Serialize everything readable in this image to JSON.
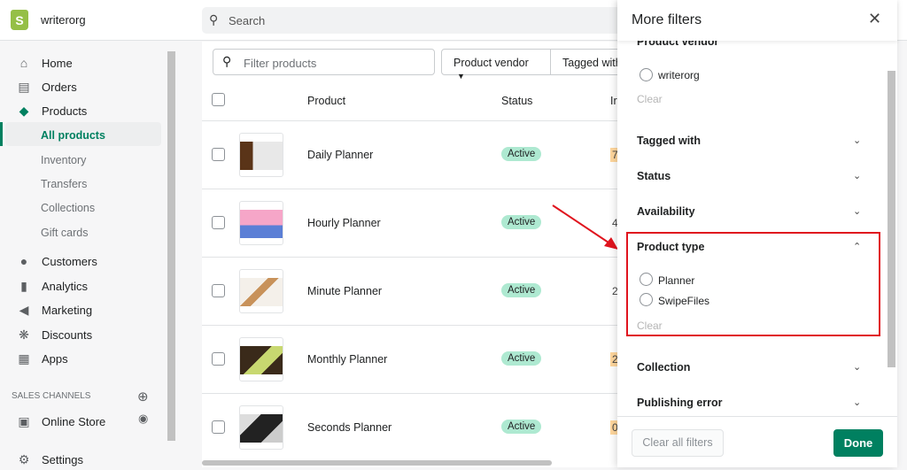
{
  "store": {
    "name": "writerorg"
  },
  "search": {
    "placeholder": "Search"
  },
  "sidebar": {
    "items": [
      {
        "label": "Home",
        "icon": "home-icon"
      },
      {
        "label": "Orders",
        "icon": "orders-icon"
      },
      {
        "label": "Products",
        "icon": "tag-icon"
      },
      {
        "label": "Customers",
        "icon": "person-icon"
      },
      {
        "label": "Analytics",
        "icon": "bar-chart-icon"
      },
      {
        "label": "Marketing",
        "icon": "megaphone-icon"
      },
      {
        "label": "Discounts",
        "icon": "discount-icon"
      },
      {
        "label": "Apps",
        "icon": "apps-icon"
      }
    ],
    "sub_items": [
      "All products",
      "Inventory",
      "Transfers",
      "Collections",
      "Gift cards"
    ],
    "sales_channels": "SALES CHANNELS",
    "online_store": "Online Store",
    "settings": "Settings"
  },
  "main": {
    "filter_placeholder": "Filter products",
    "vendor_btn": "Product vendor",
    "tagged_btn": "Tagged with",
    "columns": {
      "product": "Product",
      "status": "Status",
      "inventory": "Ir"
    },
    "rows": [
      {
        "name": "Daily Planner",
        "status": "Active",
        "inventory": "7"
      },
      {
        "name": "Hourly Planner",
        "status": "Active",
        "inventory": "4"
      },
      {
        "name": "Minute Planner",
        "status": "Active",
        "inventory": "2"
      },
      {
        "name": "Monthly Planner",
        "status": "Active",
        "inventory": "2"
      },
      {
        "name": "Seconds Planner",
        "status": "Active",
        "inventory": "0"
      }
    ]
  },
  "panel": {
    "title": "More filters",
    "vendor": {
      "label": "Product vendor",
      "option": "writerorg",
      "clear": "Clear"
    },
    "tagged": "Tagged with",
    "status": "Status",
    "availability": "Availability",
    "product_type": {
      "label": "Product type",
      "options": [
        "Planner",
        "SwipeFiles"
      ],
      "clear": "Clear"
    },
    "collection": "Collection",
    "publishing_error": "Publishing error",
    "clear_all": "Clear all filters",
    "done": "Done"
  },
  "colors": {
    "accent": "#008060",
    "badge": "#aee9d1",
    "highlight": "#e0141e"
  }
}
